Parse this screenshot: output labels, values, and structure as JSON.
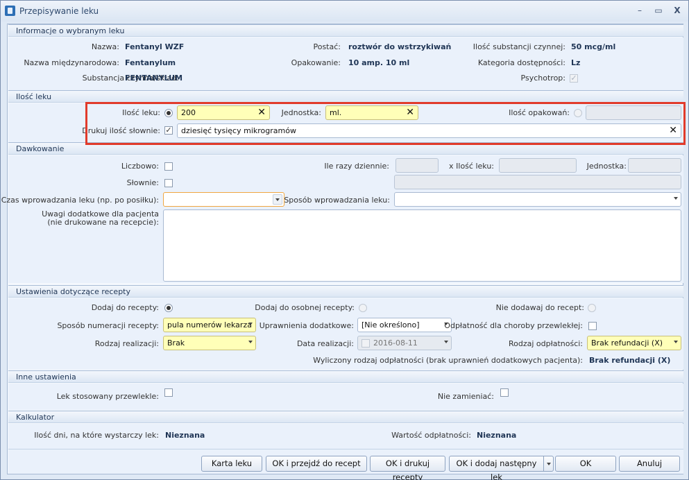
{
  "window": {
    "title": "Przepisywanie leku",
    "minimize": "–",
    "maximize": "▭",
    "close": "X"
  },
  "info": {
    "header": "Informacje o wybranym leku",
    "nazwa_label": "Nazwa:",
    "nazwa": "Fentanyl WZF",
    "postac_label": "Postać:",
    "postac": "roztwór do wstrzykiwań",
    "ilosc_subst_label": "Ilość substancji czynnej:",
    "ilosc_subst": "50 mcg/ml",
    "nazwa_miedzy_label": "Nazwa międzynarodowa:",
    "nazwa_miedzy": "Fentanylum",
    "opakowanie_label": "Opakowanie:",
    "opakowanie": "10 amp. 10 ml",
    "kategoria_label": "Kategoria dostępności:",
    "kategoria": "Lz",
    "substancja_label": "Substancja czynna/skład:",
    "substancja": "FENTANYLUM",
    "psychotrop_label": "Psychotrop:",
    "psychotrop_check": "✓"
  },
  "ilosc": {
    "header": "Ilość leku",
    "ilosc_leku_label": "Ilość leku:",
    "ilosc_leku_value": "200",
    "jednostka_label": "Jednostka:",
    "jednostka_value": "ml.",
    "ilosc_opakowan_label": "Ilość opakowań:",
    "drukuj_label": "Drukuj ilość słownie:",
    "drukuj_check": "✓",
    "slownie_value": "dziesięć tysięcy mikrogramów",
    "clear": "✕"
  },
  "dawkowanie": {
    "header": "Dawkowanie",
    "liczbowo_label": "Liczbowo:",
    "ile_razy_label": "Ile razy dziennie:",
    "x": "x",
    "ilosc_leku_label": "Ilość leku:",
    "jednostka_label": "Jednostka:",
    "slownie_label": "Słownie:",
    "czas_label": "Czas wprowadzania leku (np. po posiłku):",
    "sposob_label": "Sposób wprowadzania leku:",
    "uwagi_label_1": "Uwagi dodatkowe dla pacjenta",
    "uwagi_label_2": "(nie drukowane na recepcie):"
  },
  "recepta": {
    "header": "Ustawienia dotyczące recepty",
    "dodaj_label": "Dodaj do recepty:",
    "dodaj_osobnej_label": "Dodaj do osobnej recepty:",
    "nie_dodawaj_label": "Nie dodawaj do recept:",
    "sposob_numeracji_label": "Sposób numeracji recepty:",
    "sposob_numeracji_value": "pula numerów lekarza",
    "uprawnienia_label": "Uprawnienia dodatkowe:",
    "uprawnienia_value": "[Nie określono]",
    "odplatnosc_choroby_label": "Odpłatność dla choroby przewlekłej:",
    "rodzaj_realizacji_label": "Rodzaj realizacji:",
    "rodzaj_realizacji_value": "Brak",
    "data_realizacji_label": "Data realizacji:",
    "data_realizacji_value": "2016-08-11",
    "rodzaj_odplatnosci_label": "Rodzaj odpłatności:",
    "rodzaj_odplatnosci_value": "Brak refundacji (X)",
    "wyliczony_label": "Wyliczony rodzaj odpłatności (brak uprawnień dodatkowych pacjenta):",
    "wyliczony_value": "Brak refundacji (X)"
  },
  "inne": {
    "header": "Inne ustawienia",
    "przewlekle_label": "Lek stosowany przewlekle:",
    "nie_zamieniac_label": "Nie zamieniać:"
  },
  "kalkulator": {
    "header": "Kalkulator",
    "ilosc_dni_label": "Ilość dni, na które wystarczy lek:",
    "ilosc_dni_value": "Nieznana",
    "wartosc_label": "Wartość odpłatności:",
    "wartosc_value": "Nieznana"
  },
  "buttons": {
    "karta_leku": "Karta leku",
    "ok_przejdz": "OK i przejdź do recept",
    "ok_drukuj": "OK i drukuj recepty",
    "ok_dodaj": "OK i dodaj następny lek",
    "ok": "OK",
    "anuluj": "Anuluj"
  }
}
